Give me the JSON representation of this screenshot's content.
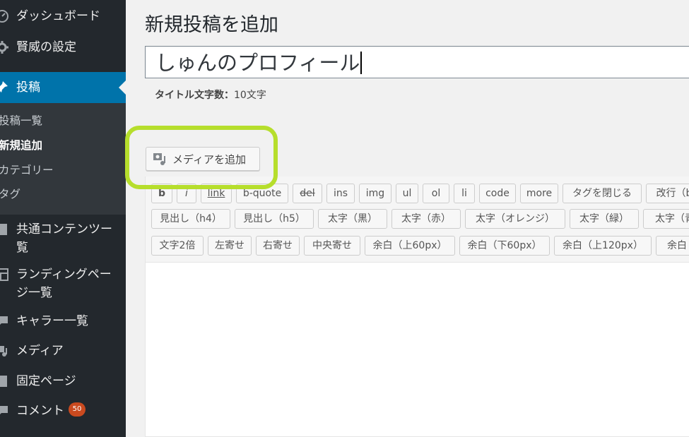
{
  "sidebar": {
    "dashboard": "ダッシュボード",
    "kenshin_settings": "賢威の設定",
    "posts": "投稿",
    "sub_all_posts": "投稿一覧",
    "sub_add_new": "新規追加",
    "sub_categories": "カテゴリー",
    "sub_tags": "タグ",
    "common_content_line1": "共通コンテンツー",
    "common_content_line2": "覧",
    "landing_line1": "ランディングペー",
    "landing_line2": "ジ一覧",
    "character_list": "キャラー一覧",
    "media": "メディア",
    "pages": "固定ページ",
    "comments": "コメント",
    "comments_badge": "50"
  },
  "main": {
    "page_title": "新規投稿を追加",
    "post_title_value": "しゅんのプロフィール",
    "title_count_label": "タイトル文字数：",
    "title_count_value": "10文字",
    "add_media_label": "メディアを追加"
  },
  "quicktags": {
    "row1": [
      "b",
      "i",
      "link",
      "b-quote",
      "del",
      "ins",
      "img",
      "ul",
      "ol",
      "li",
      "code",
      "more",
      "タグを閉じる",
      "改行（b"
    ],
    "row2": [
      "見出し（h4）",
      "見出し（h5）",
      "太字（黒）",
      "太字（赤）",
      "太字（オレンジ）",
      "太字（緑）",
      "太字（青"
    ],
    "row3": [
      "文字2倍",
      "左寄せ",
      "右寄せ",
      "中央寄せ",
      "余白（上60px）",
      "余白（下60px）",
      "余白（上120px）",
      "余白"
    ]
  },
  "colors": {
    "sidebar_bg": "#23282d",
    "submenu_bg": "#32373c",
    "active_bg": "#0073aa",
    "badge_bg": "#ca4a1f",
    "highlight_ring": "#b6de2c"
  }
}
